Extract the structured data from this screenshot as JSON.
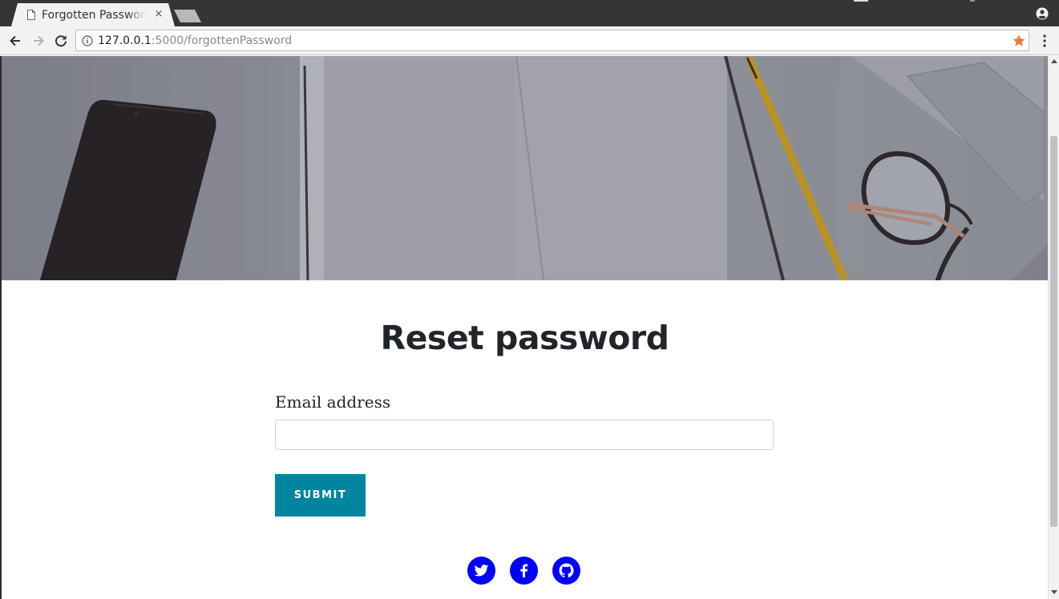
{
  "browser": {
    "tab_title": "Forgotten Password",
    "tab_close_glyph": "×",
    "url_host": "127.0.0.1",
    "url_path": ":5000/forgottenPassword",
    "icons": {
      "tab": "document-icon",
      "back": "back-arrow-icon",
      "forward": "forward-arrow-icon",
      "reload": "reload-icon",
      "site_info": "info-icon",
      "bookmark": "star-icon",
      "menu": "kebab-menu-icon",
      "profile": "profile-icon"
    },
    "bookmark_color": "#f07a38"
  },
  "page": {
    "title": "Reset password",
    "form": {
      "email_label": "Email address",
      "email_value": "",
      "submit_label": "SUBMIT"
    },
    "social": [
      {
        "name": "twitter",
        "icon": "twitter-icon"
      },
      {
        "name": "facebook",
        "icon": "facebook-icon"
      },
      {
        "name": "github",
        "icon": "github-icon"
      }
    ],
    "colors": {
      "accent": "#0085a1",
      "social_bg": "#0000ff",
      "title": "#212529"
    }
  }
}
